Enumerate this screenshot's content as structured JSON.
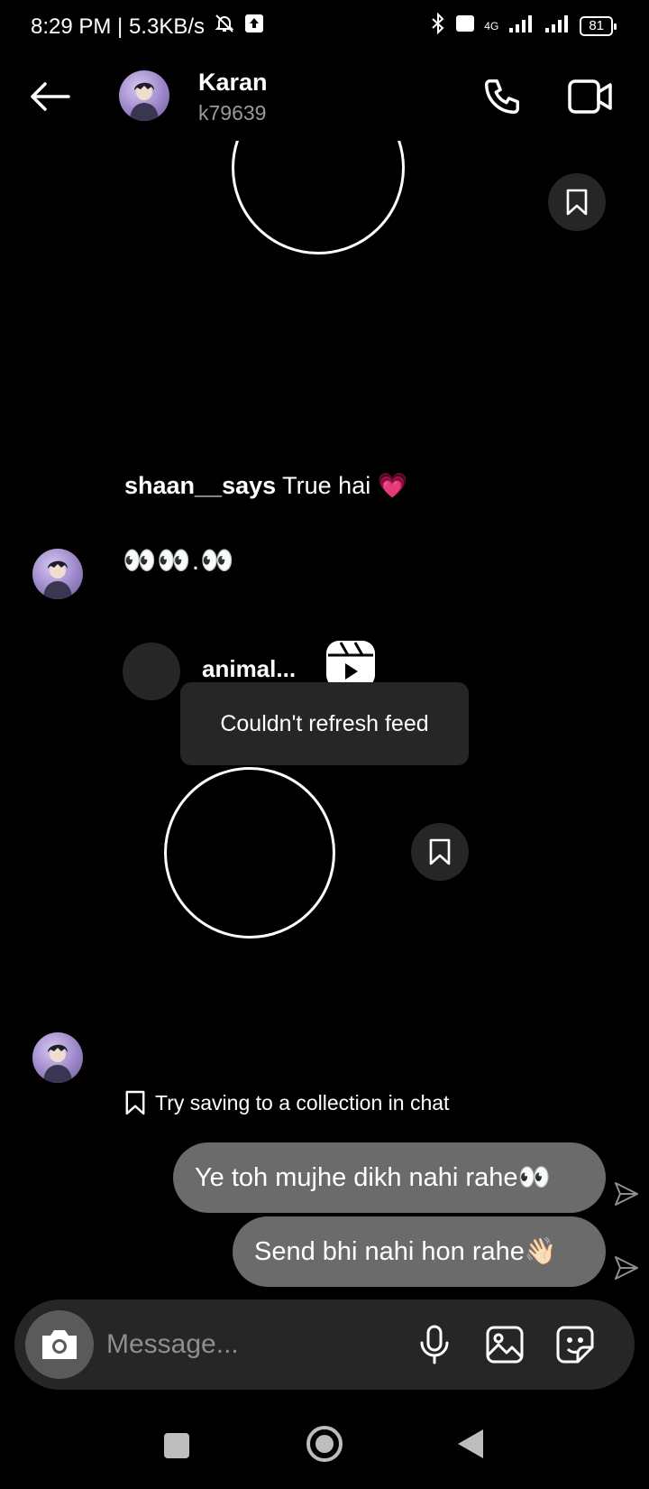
{
  "status_bar": {
    "time_speed": "8:29 PM | 5.3KB/s",
    "network": "4G",
    "battery": "81"
  },
  "header": {
    "name": "Karan",
    "username": "k79639"
  },
  "chat": {
    "caption_user": "shaan__says",
    "caption_text": "True hai 💗",
    "emoji_message": "👀👀.👀",
    "reel_account": "animal...",
    "toast": "Couldn't refresh feed",
    "collection_hint": "Try saving to a collection in chat",
    "sent_messages": [
      "Ye toh mujhe dikh nahi rahe👀",
      "Send bhi nahi hon rahe👋🏻"
    ]
  },
  "composer": {
    "placeholder": "Message..."
  },
  "colors": {
    "background": "#000000",
    "bubble": "#6b6b6b",
    "surface": "#262626"
  },
  "icons": [
    "back-arrow-icon",
    "phone-icon",
    "video-call-icon",
    "bookmark-icon",
    "reels-icon",
    "send-icon",
    "camera-icon",
    "microphone-icon",
    "gallery-icon",
    "sticker-icon"
  ]
}
